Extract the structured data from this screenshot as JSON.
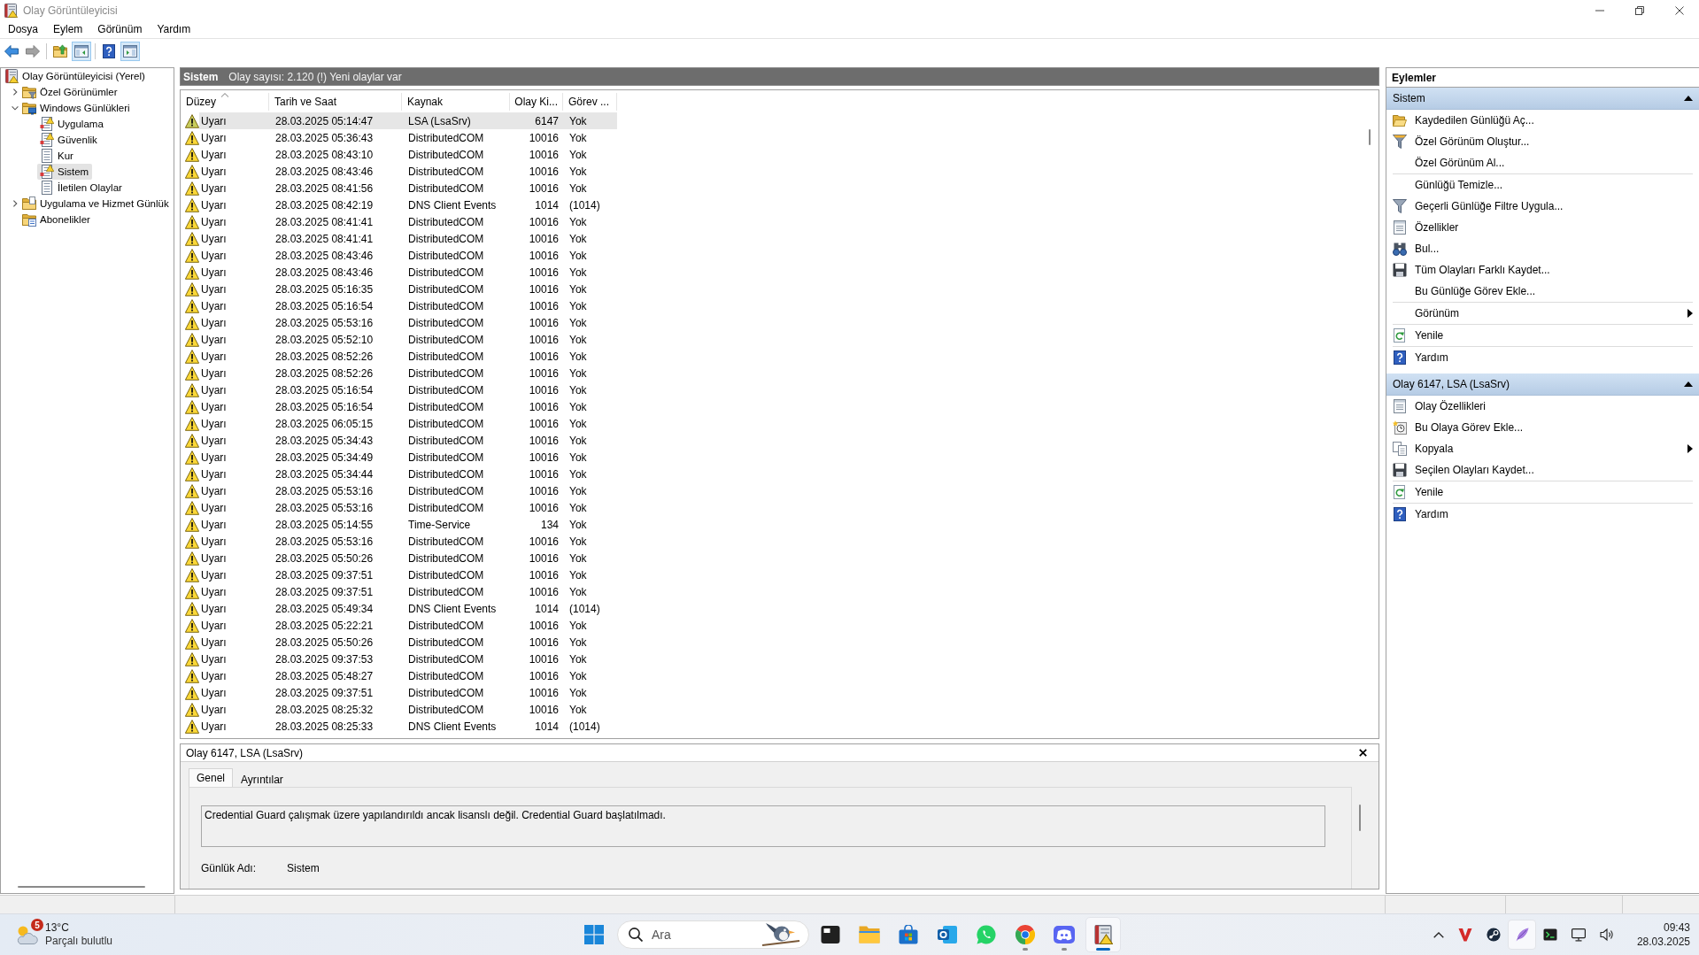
{
  "window": {
    "title": "Olay Görüntüleyicisi"
  },
  "menu": [
    {
      "label": "Dosya"
    },
    {
      "label": "Eylem"
    },
    {
      "label": "Görünüm"
    },
    {
      "label": "Yardım"
    }
  ],
  "toolbar": {
    "groups": [
      {
        "buttons": [
          {
            "kind": "back",
            "pressed": false,
            "disabled": false
          },
          {
            "kind": "forward",
            "pressed": false,
            "disabled": true
          }
        ]
      },
      {
        "buttons": [
          {
            "kind": "up",
            "pressed": false,
            "disabled": false
          },
          {
            "kind": "tree",
            "pressed": true,
            "disabled": false
          }
        ]
      },
      {
        "buttons": [
          {
            "kind": "help",
            "pressed": false,
            "disabled": false
          },
          {
            "kind": "pane",
            "pressed": true,
            "disabled": false
          }
        ]
      }
    ]
  },
  "tree": [
    {
      "label": "Olay Görüntüleyicisi (Yerel)",
      "kind": "root",
      "selected": false,
      "children": [
        {
          "label": "Özel Görünümler",
          "kind": "custom-views",
          "expanded": false,
          "selected": false
        },
        {
          "label": "Windows Günlükleri",
          "kind": "windows-logs",
          "expanded": true,
          "selected": false,
          "children": [
            {
              "label": "Uygulama",
              "kind": "log-alert",
              "selected": false
            },
            {
              "label": "Güvenlik",
              "kind": "log-alert",
              "selected": false
            },
            {
              "label": "Kur",
              "kind": "log",
              "selected": false
            },
            {
              "label": "Sistem",
              "kind": "log-alert",
              "selected": true
            },
            {
              "label": "İletilen Olaylar",
              "kind": "log",
              "selected": false
            }
          ]
        },
        {
          "label": "Uygulama ve Hizmet Günlük",
          "kind": "folder",
          "expanded": false,
          "selected": false
        },
        {
          "label": "Abonelikler",
          "kind": "subscriptions",
          "selected": false
        }
      ]
    }
  ],
  "events": {
    "title": "Sistem",
    "summary": "Olay sayısı: 2.120 (!) Yeni olaylar var",
    "columns": [
      {
        "label": "Düzey",
        "sorted": true
      },
      {
        "label": "Tarih ve Saat",
        "sorted": false
      },
      {
        "label": "Kaynak",
        "sorted": false
      },
      {
        "label": "Olay Ki...",
        "sorted": false
      },
      {
        "label": "Görev ...",
        "sorted": false
      }
    ],
    "rows": [
      {
        "cells": [
          "Uyarı",
          "28.03.2025 05:14:47",
          "LSA (LsaSrv)",
          "6147",
          "Yok"
        ],
        "selected": true
      },
      {
        "cells": [
          "Uyarı",
          "28.03.2025 05:36:43",
          "DistributedCOM",
          "10016",
          "Yok"
        ],
        "selected": false
      },
      {
        "cells": [
          "Uyarı",
          "28.03.2025 08:43:10",
          "DistributedCOM",
          "10016",
          "Yok"
        ],
        "selected": false
      },
      {
        "cells": [
          "Uyarı",
          "28.03.2025 08:43:46",
          "DistributedCOM",
          "10016",
          "Yok"
        ],
        "selected": false
      },
      {
        "cells": [
          "Uyarı",
          "28.03.2025 08:41:56",
          "DistributedCOM",
          "10016",
          "Yok"
        ],
        "selected": false
      },
      {
        "cells": [
          "Uyarı",
          "28.03.2025 08:42:19",
          "DNS Client Events",
          "1014",
          "(1014)"
        ],
        "selected": false
      },
      {
        "cells": [
          "Uyarı",
          "28.03.2025 08:41:41",
          "DistributedCOM",
          "10016",
          "Yok"
        ],
        "selected": false
      },
      {
        "cells": [
          "Uyarı",
          "28.03.2025 08:41:41",
          "DistributedCOM",
          "10016",
          "Yok"
        ],
        "selected": false
      },
      {
        "cells": [
          "Uyarı",
          "28.03.2025 08:43:46",
          "DistributedCOM",
          "10016",
          "Yok"
        ],
        "selected": false
      },
      {
        "cells": [
          "Uyarı",
          "28.03.2025 08:43:46",
          "DistributedCOM",
          "10016",
          "Yok"
        ],
        "selected": false
      },
      {
        "cells": [
          "Uyarı",
          "28.03.2025 05:16:35",
          "DistributedCOM",
          "10016",
          "Yok"
        ],
        "selected": false
      },
      {
        "cells": [
          "Uyarı",
          "28.03.2025 05:16:54",
          "DistributedCOM",
          "10016",
          "Yok"
        ],
        "selected": false
      },
      {
        "cells": [
          "Uyarı",
          "28.03.2025 05:53:16",
          "DistributedCOM",
          "10016",
          "Yok"
        ],
        "selected": false
      },
      {
        "cells": [
          "Uyarı",
          "28.03.2025 05:52:10",
          "DistributedCOM",
          "10016",
          "Yok"
        ],
        "selected": false
      },
      {
        "cells": [
          "Uyarı",
          "28.03.2025 08:52:26",
          "DistributedCOM",
          "10016",
          "Yok"
        ],
        "selected": false
      },
      {
        "cells": [
          "Uyarı",
          "28.03.2025 08:52:26",
          "DistributedCOM",
          "10016",
          "Yok"
        ],
        "selected": false
      },
      {
        "cells": [
          "Uyarı",
          "28.03.2025 05:16:54",
          "DistributedCOM",
          "10016",
          "Yok"
        ],
        "selected": false
      },
      {
        "cells": [
          "Uyarı",
          "28.03.2025 05:16:54",
          "DistributedCOM",
          "10016",
          "Yok"
        ],
        "selected": false
      },
      {
        "cells": [
          "Uyarı",
          "28.03.2025 06:05:15",
          "DistributedCOM",
          "10016",
          "Yok"
        ],
        "selected": false
      },
      {
        "cells": [
          "Uyarı",
          "28.03.2025 05:34:43",
          "DistributedCOM",
          "10016",
          "Yok"
        ],
        "selected": false
      },
      {
        "cells": [
          "Uyarı",
          "28.03.2025 05:34:49",
          "DistributedCOM",
          "10016",
          "Yok"
        ],
        "selected": false
      },
      {
        "cells": [
          "Uyarı",
          "28.03.2025 05:34:44",
          "DistributedCOM",
          "10016",
          "Yok"
        ],
        "selected": false
      },
      {
        "cells": [
          "Uyarı",
          "28.03.2025 05:53:16",
          "DistributedCOM",
          "10016",
          "Yok"
        ],
        "selected": false
      },
      {
        "cells": [
          "Uyarı",
          "28.03.2025 05:53:16",
          "DistributedCOM",
          "10016",
          "Yok"
        ],
        "selected": false
      },
      {
        "cells": [
          "Uyarı",
          "28.03.2025 05:14:55",
          "Time-Service",
          "134",
          "Yok"
        ],
        "selected": false
      },
      {
        "cells": [
          "Uyarı",
          "28.03.2025 05:53:16",
          "DistributedCOM",
          "10016",
          "Yok"
        ],
        "selected": false
      },
      {
        "cells": [
          "Uyarı",
          "28.03.2025 05:50:26",
          "DistributedCOM",
          "10016",
          "Yok"
        ],
        "selected": false
      },
      {
        "cells": [
          "Uyarı",
          "28.03.2025 09:37:51",
          "DistributedCOM",
          "10016",
          "Yok"
        ],
        "selected": false
      },
      {
        "cells": [
          "Uyarı",
          "28.03.2025 09:37:51",
          "DistributedCOM",
          "10016",
          "Yok"
        ],
        "selected": false
      },
      {
        "cells": [
          "Uyarı",
          "28.03.2025 05:49:34",
          "DNS Client Events",
          "1014",
          "(1014)"
        ],
        "selected": false
      },
      {
        "cells": [
          "Uyarı",
          "28.03.2025 05:22:21",
          "DistributedCOM",
          "10016",
          "Yok"
        ],
        "selected": false
      },
      {
        "cells": [
          "Uyarı",
          "28.03.2025 05:50:26",
          "DistributedCOM",
          "10016",
          "Yok"
        ],
        "selected": false
      },
      {
        "cells": [
          "Uyarı",
          "28.03.2025 09:37:53",
          "DistributedCOM",
          "10016",
          "Yok"
        ],
        "selected": false
      },
      {
        "cells": [
          "Uyarı",
          "28.03.2025 05:48:27",
          "DistributedCOM",
          "10016",
          "Yok"
        ],
        "selected": false
      },
      {
        "cells": [
          "Uyarı",
          "28.03.2025 09:37:51",
          "DistributedCOM",
          "10016",
          "Yok"
        ],
        "selected": false
      },
      {
        "cells": [
          "Uyarı",
          "28.03.2025 08:25:32",
          "DistributedCOM",
          "10016",
          "Yok"
        ],
        "selected": false
      },
      {
        "cells": [
          "Uyarı",
          "28.03.2025 08:25:33",
          "DNS Client Events",
          "1014",
          "(1014)"
        ],
        "selected": false
      }
    ]
  },
  "details": {
    "title": "Olay 6147, LSA (LsaSrv)",
    "tabs": [
      {
        "label": "Genel",
        "selected": true
      },
      {
        "label": "Ayrıntılar",
        "selected": false
      }
    ],
    "description": "Credential Guard çalışmak üzere yapılandırıldı ancak lisanslı değil. Credential Guard başlatılmadı.",
    "fields": [
      {
        "label": "Günlük Adı:",
        "value": "Sistem"
      }
    ]
  },
  "actions": {
    "title": "Eylemler",
    "sections": [
      {
        "title": "Sistem",
        "expanded": true,
        "items": [
          {
            "label": "Kaydedilen Günlüğü Aç...",
            "kind": "open",
            "submenu": false,
            "divider": false
          },
          {
            "label": "Özel Görünüm Oluştur...",
            "kind": "create-view",
            "submenu": false,
            "divider": false
          },
          {
            "label": "Özel Görünüm Al...",
            "kind": "none",
            "submenu": false,
            "divider": true
          },
          {
            "label": "Günlüğü Temizle...",
            "kind": "none",
            "submenu": false,
            "divider": false
          },
          {
            "label": "Geçerli Günlüğe Filtre Uygula...",
            "kind": "filter",
            "submenu": false,
            "divider": false
          },
          {
            "label": "Özellikler",
            "kind": "properties",
            "submenu": false,
            "divider": false
          },
          {
            "label": "Bul...",
            "kind": "find",
            "submenu": false,
            "divider": false
          },
          {
            "label": "Tüm Olayları Farklı Kaydet...",
            "kind": "save",
            "submenu": false,
            "divider": false
          },
          {
            "label": "Bu Günlüğe Görev Ekle...",
            "kind": "none",
            "submenu": false,
            "divider": true
          },
          {
            "label": "Görünüm",
            "kind": "none",
            "submenu": true,
            "divider": true
          },
          {
            "label": "Yenile",
            "kind": "refresh",
            "submenu": false,
            "divider": true
          },
          {
            "label": "Yardım",
            "kind": "help",
            "submenu": false,
            "divider": false
          }
        ]
      },
      {
        "title": "Olay 6147, LSA (LsaSrv)",
        "expanded": true,
        "items": [
          {
            "label": "Olay Özellikleri",
            "kind": "properties",
            "submenu": false,
            "divider": false
          },
          {
            "label": "Bu Olaya Görev Ekle...",
            "kind": "task",
            "submenu": false,
            "divider": false
          },
          {
            "label": "Kopyala",
            "kind": "copy",
            "submenu": true,
            "divider": false
          },
          {
            "label": "Seçilen Olayları Kaydet...",
            "kind": "save",
            "submenu": false,
            "divider": true
          },
          {
            "label": "Yenile",
            "kind": "refresh",
            "submenu": false,
            "divider": true
          },
          {
            "label": "Yardım",
            "kind": "help",
            "submenu": false,
            "divider": false
          }
        ]
      }
    ]
  },
  "taskbar": {
    "weather": {
      "badge": "5",
      "temperature": "13°C",
      "condition": "Parçalı bulutlu"
    },
    "search": {
      "placeholder": "Ara"
    },
    "apps": [
      {
        "kind": "window",
        "running": false,
        "active": false
      },
      {
        "kind": "folder",
        "running": false,
        "active": false
      },
      {
        "kind": "store",
        "running": false,
        "active": false
      },
      {
        "kind": "mail",
        "running": false,
        "active": false
      },
      {
        "kind": "chat",
        "running": false,
        "active": false
      },
      {
        "kind": "browser",
        "running": true,
        "active": false
      },
      {
        "kind": "controller",
        "running": true,
        "active": false
      },
      {
        "kind": "logbook",
        "running": true,
        "active": true
      }
    ],
    "tray": [
      {
        "kind": "chevron",
        "selected": false
      },
      {
        "kind": "v-mark",
        "selected": false
      },
      {
        "kind": "disc",
        "selected": false
      },
      {
        "kind": "feather",
        "selected": true
      },
      {
        "kind": "terminal",
        "selected": false
      },
      {
        "kind": "monitor",
        "selected": false
      },
      {
        "kind": "speaker",
        "selected": false
      }
    ],
    "clock": {
      "time": "09:43",
      "date": "28.03.2025"
    }
  }
}
